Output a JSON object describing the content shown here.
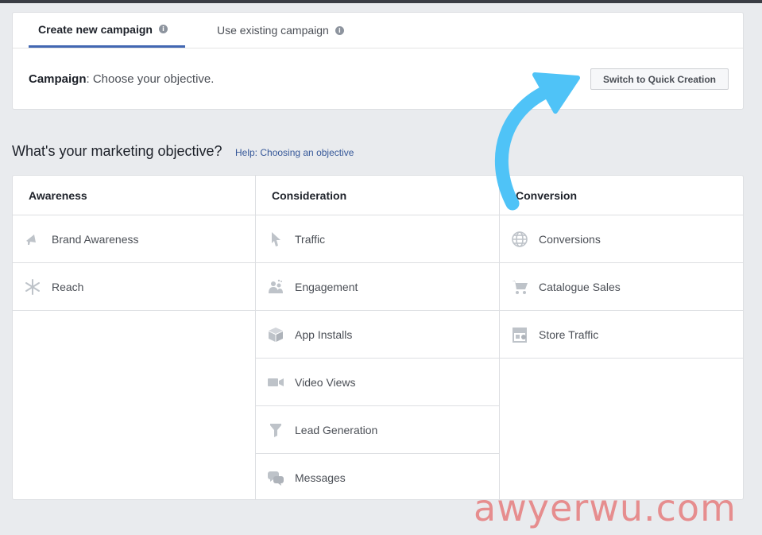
{
  "tabs": {
    "create": "Create new campaign",
    "existing": "Use existing campaign"
  },
  "campaign": {
    "label": "Campaign",
    "text": ": Choose your objective.",
    "quick_button": "Switch to Quick Creation"
  },
  "question": "What's your marketing objective?",
  "help_link": "Help: Choosing an objective",
  "columns": {
    "awareness": {
      "title": "Awareness",
      "items": [
        "Brand Awareness",
        "Reach"
      ]
    },
    "consideration": {
      "title": "Consideration",
      "items": [
        "Traffic",
        "Engagement",
        "App Installs",
        "Video Views",
        "Lead Generation",
        "Messages"
      ]
    },
    "conversion": {
      "title": "Conversion",
      "items": [
        "Conversions",
        "Catalogue Sales",
        "Store Traffic"
      ]
    }
  },
  "icons": {
    "info": "info-icon",
    "brand_awareness": "megaphone-icon",
    "reach": "snowflake-icon",
    "traffic": "cursor-icon",
    "engagement": "people-icon",
    "app_installs": "box-icon",
    "video_views": "video-camera-icon",
    "lead_generation": "funnel-icon",
    "messages": "chat-bubbles-icon",
    "conversions": "globe-icon",
    "catalogue_sales": "shopping-cart-icon",
    "store_traffic": "storefront-icon"
  },
  "colors": {
    "accent": "#4267b2",
    "link": "#365899",
    "arrow": "#4fc3f7",
    "icon": "#bec3c9",
    "watermark": "#e46e6e"
  },
  "watermark": "awyerwu.com"
}
